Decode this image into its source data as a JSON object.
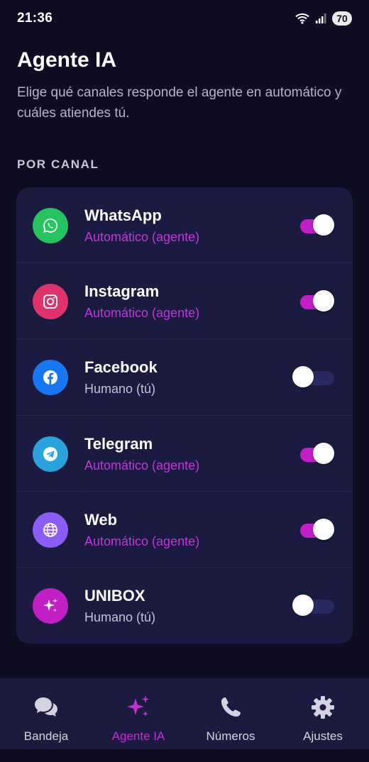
{
  "status_bar": {
    "time": "21:36",
    "battery": "70"
  },
  "header": {
    "title": "Agente IA",
    "description": "Elige qué canales responde el agente en automático y cuáles atiendes tú."
  },
  "section": {
    "label": "POR CANAL"
  },
  "channels": [
    {
      "name": "WhatsApp",
      "mode": "Automático (agente)",
      "enabled": true,
      "icon": "whatsapp-icon",
      "color": "#25c45e"
    },
    {
      "name": "Instagram",
      "mode": "Automático (agente)",
      "enabled": true,
      "icon": "instagram-icon",
      "color": "#e0336b"
    },
    {
      "name": "Facebook",
      "mode": "Humano (tú)",
      "enabled": false,
      "icon": "facebook-icon",
      "color": "#1877f2"
    },
    {
      "name": "Telegram",
      "mode": "Automático (agente)",
      "enabled": true,
      "icon": "telegram-icon",
      "color": "#2aa3dc"
    },
    {
      "name": "Web",
      "mode": "Automático (agente)",
      "enabled": true,
      "icon": "globe-icon",
      "color": "#8b5cf6"
    },
    {
      "name": "UNIBOX",
      "mode": "Humano (tú)",
      "enabled": false,
      "icon": "sparkles-icon",
      "color": "#c21fc6"
    }
  ],
  "nav": {
    "items": [
      {
        "label": "Bandeja",
        "icon": "chat-bubbles-icon"
      },
      {
        "label": "Agente IA",
        "icon": "sparkles-icon",
        "active": true
      },
      {
        "label": "Números",
        "icon": "phone-icon"
      },
      {
        "label": "Ajustes",
        "icon": "gear-icon"
      }
    ]
  },
  "colors": {
    "background": "#0f0d24",
    "card": "#1b1a40",
    "accent": "#c21fc6",
    "nav_bg": "#1c1a3e"
  }
}
